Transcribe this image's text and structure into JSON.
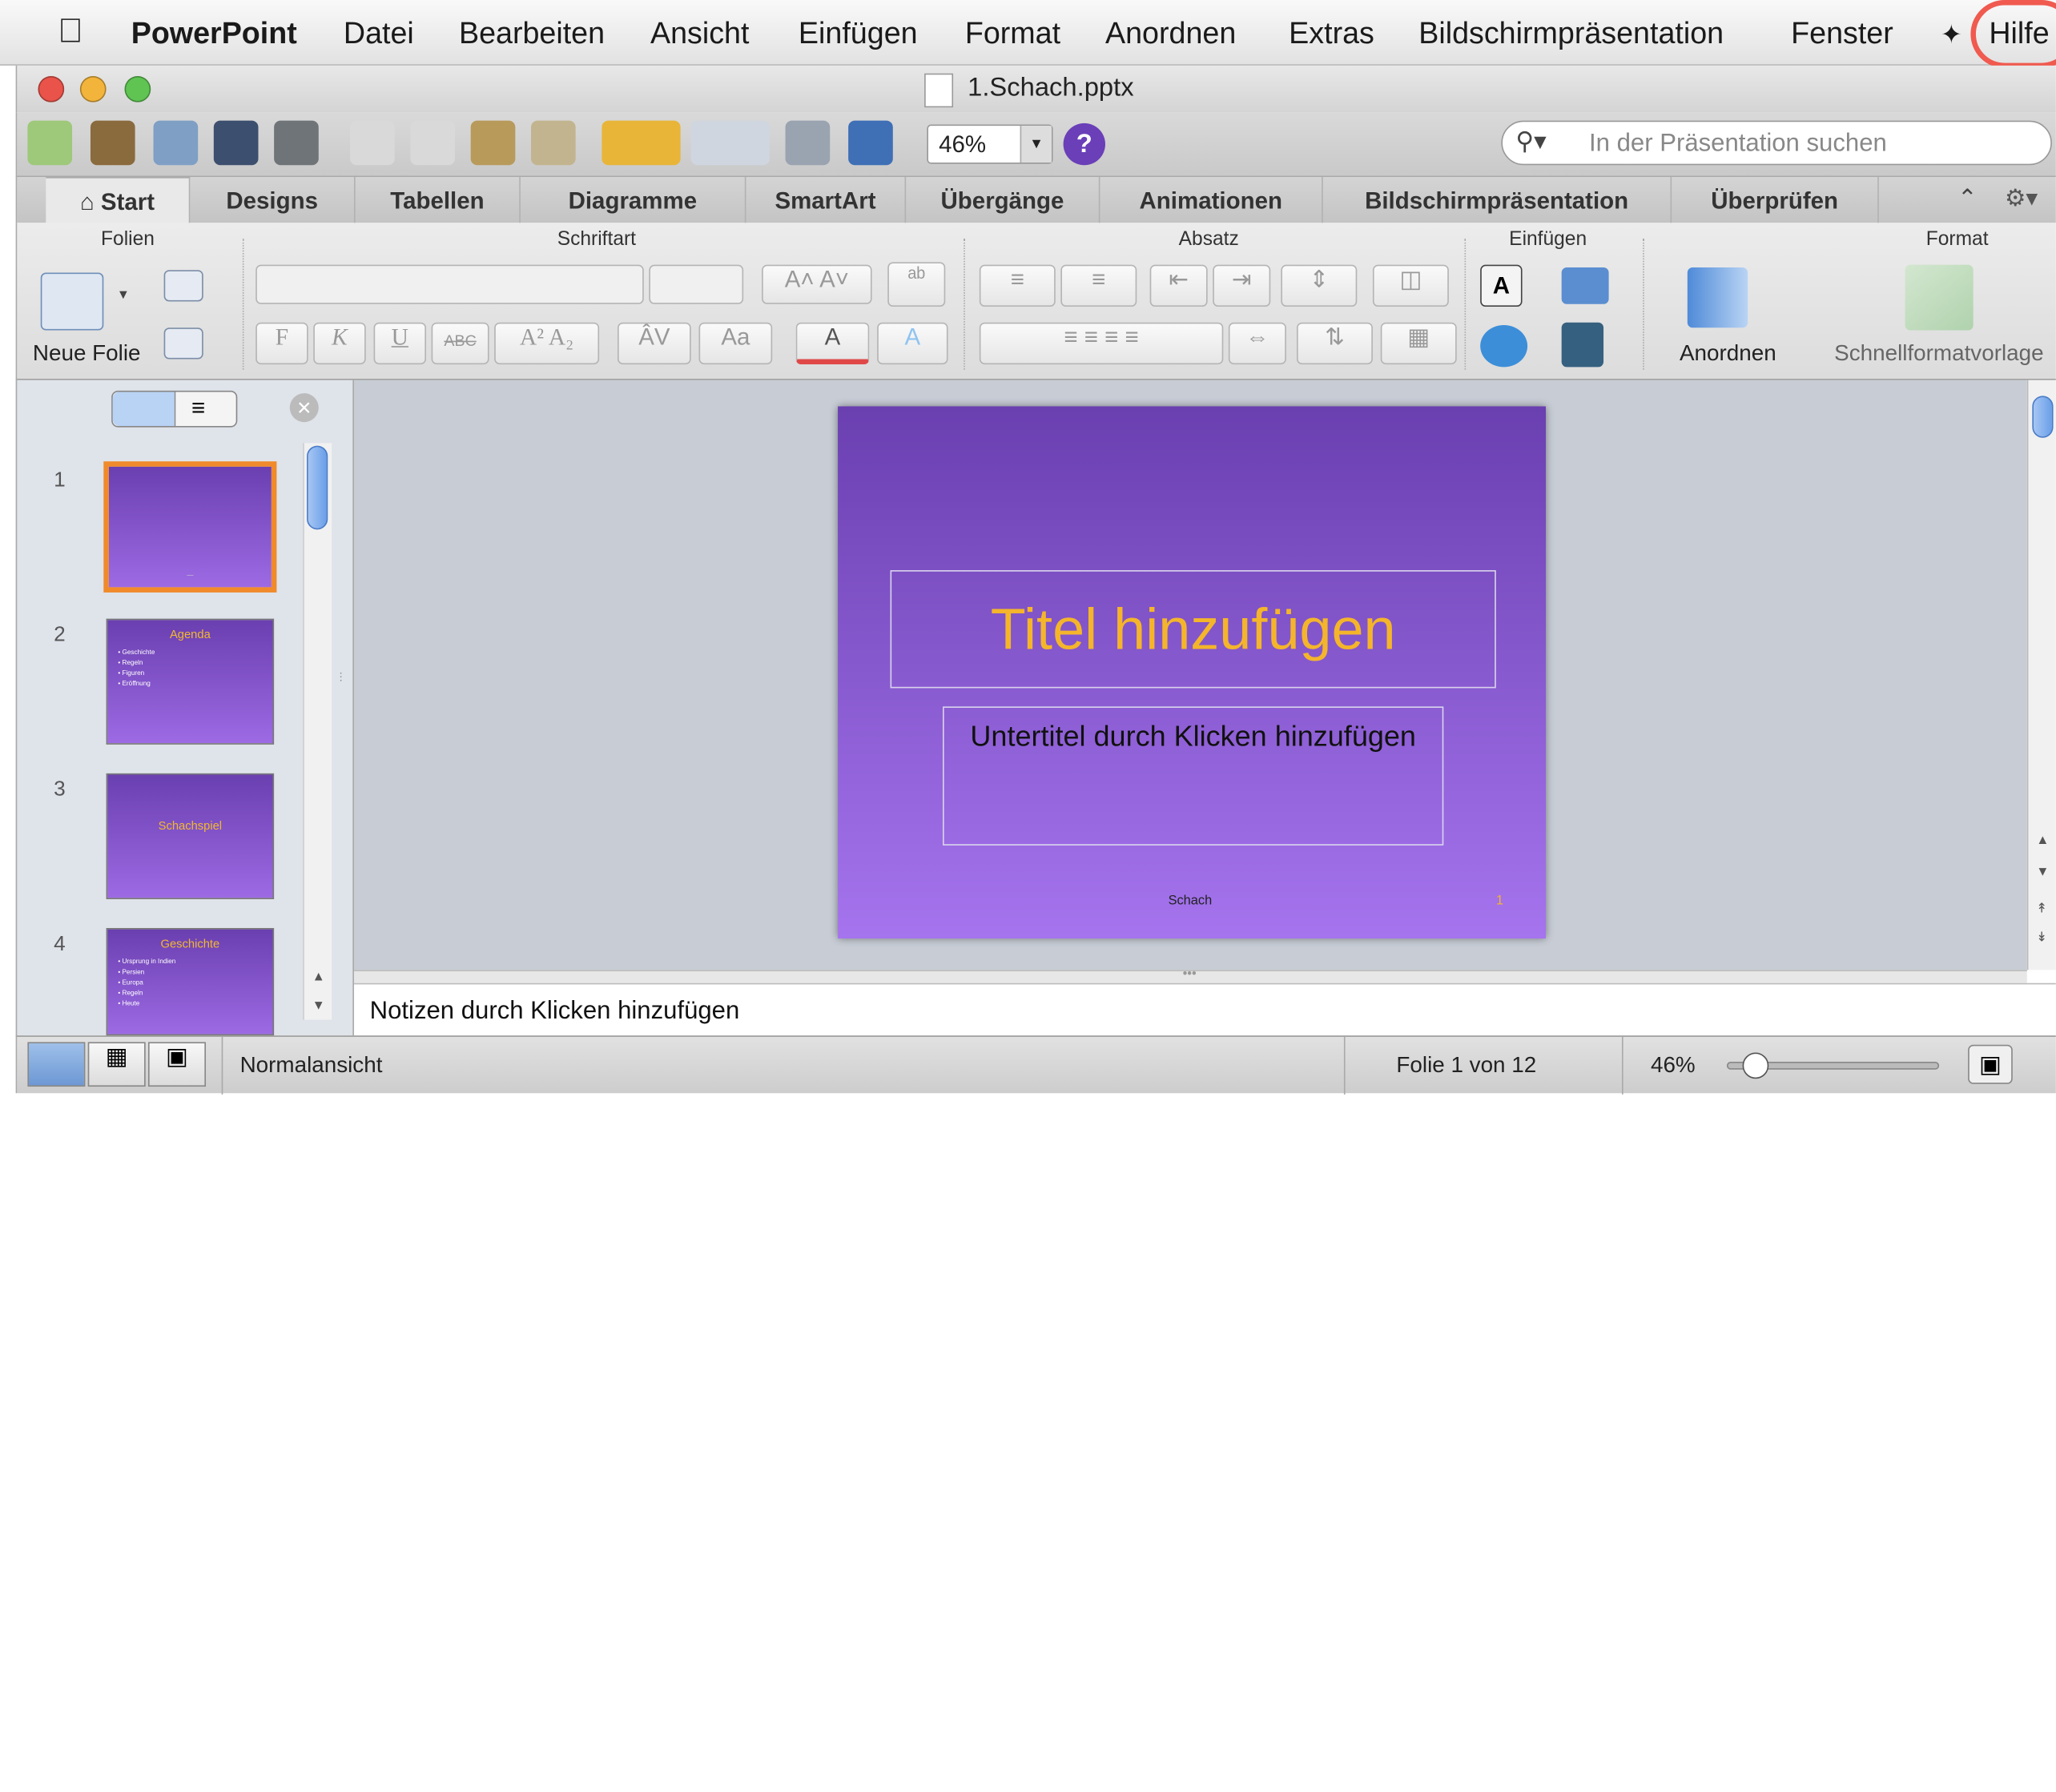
{
  "menubar": {
    "app": "PowerPoint",
    "items": [
      "Datei",
      "Bearbeiten",
      "Ansicht",
      "Einfügen",
      "Format",
      "Anordnen",
      "Extras",
      "Bildschirmpräsentation",
      "Fenster",
      "Hilfe"
    ]
  },
  "window": {
    "title": "1.Schach.pptx"
  },
  "toolbar": {
    "zoom": "46%",
    "search_placeholder": "In der Präsentation suchen",
    "help": "?"
  },
  "tabs": [
    "Start",
    "Designs",
    "Tabellen",
    "Diagramme",
    "SmartArt",
    "Übergänge",
    "Animationen",
    "Bildschirmpräsentation",
    "Überprüfen"
  ],
  "ribbon": {
    "groups": {
      "folien": "Folien",
      "schriftart": "Schriftart",
      "absatz": "Absatz",
      "einfuegen": "Einfügen",
      "format": "Format"
    },
    "neue_folie": "Neue Folie",
    "anordnen": "Anordnen",
    "schnellformat": "Schnellformatvorlage",
    "font_buttons": {
      "bold": "F",
      "italic": "K",
      "underline": "U",
      "strike": "ABC"
    }
  },
  "slides": [
    {
      "num": "1",
      "title": "",
      "lines": []
    },
    {
      "num": "2",
      "title": "Agenda",
      "lines": [
        "• Geschichte",
        "• Regeln",
        "• Figuren",
        "• Eröffnung"
      ]
    },
    {
      "num": "3",
      "title": "Schachspiel",
      "lines": []
    },
    {
      "num": "4",
      "title": "Geschichte",
      "lines": [
        "• Ursprung in Indien",
        "• Persien",
        "• Europa",
        "• Regeln",
        "• Heute"
      ]
    }
  ],
  "current_slide": {
    "title": "Titel hinzufügen",
    "subtitle": "Untertitel durch Klicken hinzufügen",
    "footer": "Schach",
    "page": "1"
  },
  "notes_placeholder": "Notizen durch Klicken hinzufügen",
  "status": {
    "view": "Normalansicht",
    "slide_of": "Folie 1 von 12",
    "zoom": "46%",
    "zoom_fraction": 0.12
  },
  "colors": {
    "slide_top": "#6a3fb0",
    "slide_bottom": "#a574ee",
    "title": "#f4b52b",
    "highlight": "#f05a4f"
  }
}
